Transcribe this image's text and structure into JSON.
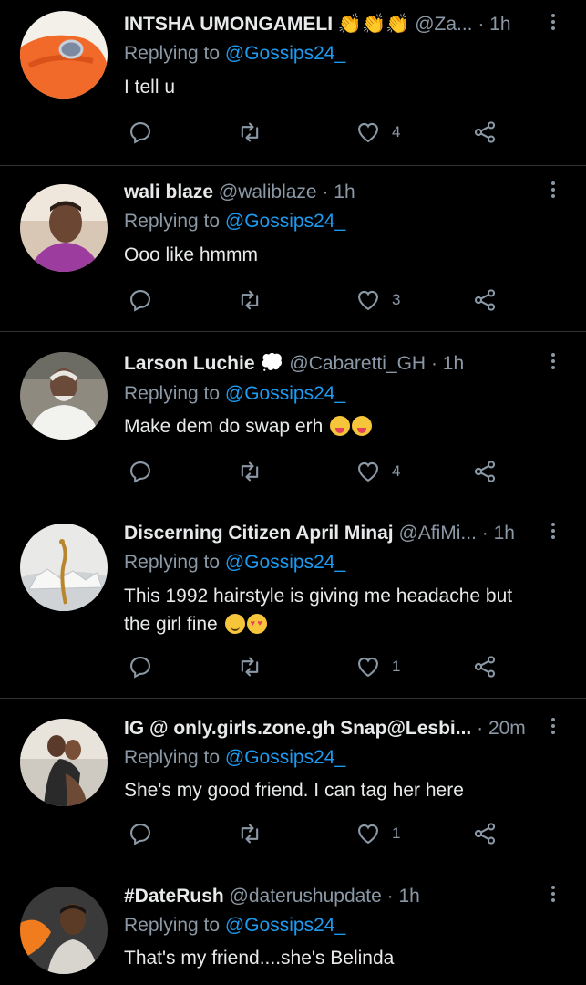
{
  "tweets": [
    {
      "name": "INTSHA UMONGAMELI",
      "badge": "👏👏👏",
      "handle": "@Za...",
      "time": "· 1h",
      "replying_prefix": "Replying to ",
      "replying_to": "@Gossips24_",
      "text": "I tell u",
      "text2": "",
      "likes": "4",
      "avatar": "orange-hand-ring"
    },
    {
      "name": "wali blaze",
      "badge": "",
      "handle": "@waliblaze",
      "time": "· 1h",
      "replying_prefix": "Replying to ",
      "replying_to": "@Gossips24_",
      "text": "Ooo like hmmm",
      "text2": "",
      "likes": "3",
      "avatar": "man-purple-light"
    },
    {
      "name": "Larson Luchie",
      "badge": "💭",
      "handle": "@Cabaretti_GH",
      "time": "· 1h",
      "replying_prefix": "Replying to ",
      "replying_to": "@Gossips24_",
      "text": "Make dem do swap erh",
      "text2": "",
      "likes": "4",
      "avatar": "old-man-white-shirt"
    },
    {
      "name": "Discerning Citizen April Minaj",
      "badge": "",
      "handle": "@AfiMi...",
      "time": "· 1h",
      "replying_prefix": "Replying to ",
      "replying_to": "@Gossips24_",
      "text": "This 1992 hairstyle is giving me headache but",
      "text2": "the girl fine",
      "likes": "1",
      "avatar": "gold-sculpture"
    },
    {
      "name": "IG @ only.girls.zone.gh Snap@Lesbi...",
      "badge": "",
      "handle": "",
      "time": "· 20m",
      "replying_prefix": "Replying to ",
      "replying_to": "@Gossips24_",
      "text": "She's my good friend. I can tag her here",
      "text2": "",
      "likes": "1",
      "avatar": "two-women"
    },
    {
      "name": "#DateRush",
      "badge": "",
      "handle": "@daterushupdate",
      "time": "· 1h",
      "replying_prefix": "Replying to ",
      "replying_to": "@Gossips24_",
      "text": "That's my friend....she's Belinda",
      "text2": "",
      "likes": "",
      "avatar": "man-orange-logo"
    }
  ],
  "colors": {
    "background": "#000000",
    "text": "#e7e9ea",
    "muted": "#8b98a5",
    "link": "#1d9bf0",
    "divider": "#2f3336"
  },
  "icons": [
    "reply-icon",
    "retweet-icon",
    "like-icon",
    "share-icon",
    "more-icon"
  ]
}
